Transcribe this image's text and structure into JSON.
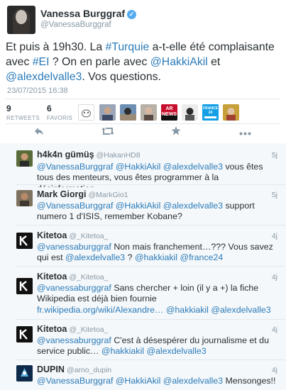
{
  "main_tweet": {
    "author_name": "Vanessa Burggraf",
    "author_handle": "@VanessaBurggraf",
    "text_parts": [
      {
        "t": "Et puis à 19h30. La ",
        "link": false
      },
      {
        "t": "#Turquie",
        "link": true
      },
      {
        "t": " a-t-elle été complaisante avec ",
        "link": false
      },
      {
        "t": "#EI",
        "link": true
      },
      {
        "t": " ? On en parle avec ",
        "link": false
      },
      {
        "t": "@HakkiAkil",
        "link": true
      },
      {
        "t": " et ",
        "link": false
      },
      {
        "t": "@alexdelvalle3",
        "link": true
      },
      {
        "t": ". Vos questions.",
        "link": false
      }
    ],
    "timestamp": "23/07/2015 16:38",
    "retweets_count": "9",
    "retweets_label": "RETWEETS",
    "favorites_count": "6",
    "favorites_label": "FAVORIS",
    "fav_avatar_badge_news": "AR NEWS",
    "fav_avatar_badge_f24": "FRANCE 24",
    "icons": [
      "reply-icon",
      "retweet-icon",
      "star-icon",
      "more-icon"
    ],
    "accent_color": "#2b7bb9"
  },
  "replies": [
    {
      "name": "h4k4n gümüş",
      "handle": "@HakanHD8",
      "age": "5j",
      "text_parts": [
        {
          "t": "@VanessaBurggraf @HakkiAkil @alexdelvalle3",
          "link": true
        },
        {
          "t": " vous êtes tous des menteurs, vous êtes programmer à la désinformation",
          "link": false
        }
      ]
    },
    {
      "name": "Mark Giorgi",
      "handle": "@MarkGio1",
      "age": "5j",
      "text_parts": [
        {
          "t": "@VanessaBurggraf @HakkiAkil @alexdelvalle3",
          "link": true
        },
        {
          "t": " support numero 1 d'ISIS, remember Kobane?",
          "link": false
        }
      ]
    },
    {
      "name": "Kitetoa",
      "handle": "@_Kitetoa_",
      "age": "4j",
      "text_parts": [
        {
          "t": "@vanessaburggraf",
          "link": true
        },
        {
          "t": " Non mais franchement…??? Vous savez qui est ",
          "link": false
        },
        {
          "t": "@alexdelvalle3",
          "link": true
        },
        {
          "t": " ? ",
          "link": false
        },
        {
          "t": "@hakkiakil",
          "link": true
        },
        {
          "t": "  ",
          "link": false
        },
        {
          "t": "@france24",
          "link": true
        }
      ]
    },
    {
      "name": "Kitetoa",
      "handle": "@_Kitetoa_",
      "age": "4j",
      "text_parts": [
        {
          "t": "@vanessaburggraf",
          "link": true
        },
        {
          "t": " Sans chercher + loin (il y a +) la fiche Wikipedia est déjà bien fournie ",
          "link": false
        },
        {
          "t": "fr.wikipedia.org/wiki/Alexandre…",
          "link": true
        },
        {
          "t": " ",
          "link": false
        },
        {
          "t": "@hakkiakil",
          "link": true
        },
        {
          "t": " ",
          "link": false
        },
        {
          "t": "@alexdelvalle3",
          "link": true
        }
      ]
    },
    {
      "name": "Kitetoa",
      "handle": "@_Kitetoa_",
      "age": "4j",
      "text_parts": [
        {
          "t": "@vanessaburggraf",
          "link": true
        },
        {
          "t": " C'est à désespérer du journalisme et du service public… ",
          "link": false
        },
        {
          "t": "@hakkiakil @alexdelvalle3",
          "link": true
        }
      ]
    },
    {
      "name": "DUPIN",
      "handle": "@arno_dupin",
      "age": "4j",
      "text_parts": [
        {
          "t": "@VanessaBurggraf @HakkiAkil @alexdelvalle3",
          "link": true
        },
        {
          "t": " Mensonges!!",
          "link": false
        }
      ]
    }
  ]
}
